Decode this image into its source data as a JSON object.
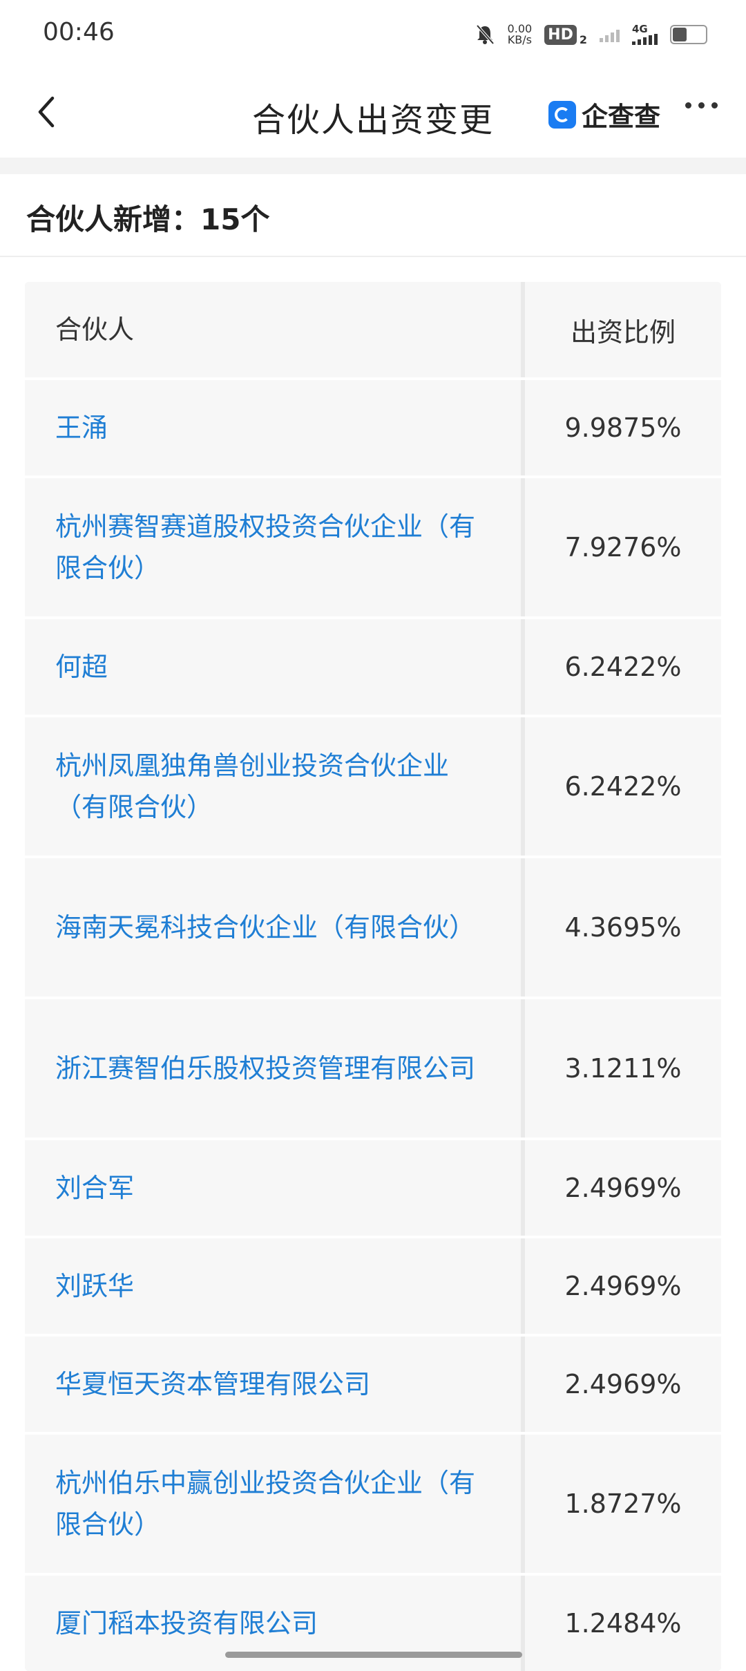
{
  "status_bar": {
    "time": "00:46",
    "net_speed_value": "0.00",
    "net_speed_unit": "KB/s",
    "hd_label": "HD",
    "hd_sub": "2",
    "network_type": "4G"
  },
  "header": {
    "title": "合伙人出资变更",
    "brand": "企查查"
  },
  "summary": {
    "label": "合伙人新增：15个"
  },
  "table": {
    "columns": [
      "合伙人",
      "出资比例"
    ],
    "rows": [
      {
        "name": "王涌",
        "ratio": "9.9875%"
      },
      {
        "name": "杭州赛智赛道股权投资合伙企业（有限合伙）",
        "ratio": "7.9276%"
      },
      {
        "name": "何超",
        "ratio": "6.2422%"
      },
      {
        "name": "杭州凤凰独角兽创业投资合伙企业（有限合伙）",
        "ratio": "6.2422%"
      },
      {
        "name": "海南天冕科技合伙企业（有限合伙）",
        "ratio": "4.3695%"
      },
      {
        "name": "浙江赛智伯乐股权投资管理有限公司",
        "ratio": "3.1211%"
      },
      {
        "name": "刘合军",
        "ratio": "2.4969%"
      },
      {
        "name": "刘跃华",
        "ratio": "2.4969%"
      },
      {
        "name": "华夏恒天资本管理有限公司",
        "ratio": "2.4969%"
      },
      {
        "name": "杭州伯乐中赢创业投资合伙企业（有限合伙）",
        "ratio": "1.8727%"
      },
      {
        "name": "厦门稻本投资有限公司",
        "ratio": "1.2484%"
      }
    ]
  },
  "colors": {
    "link": "#1f7ed4",
    "brand_blue": "#1a7cf2",
    "cell_bg": "#f7f7f7"
  }
}
